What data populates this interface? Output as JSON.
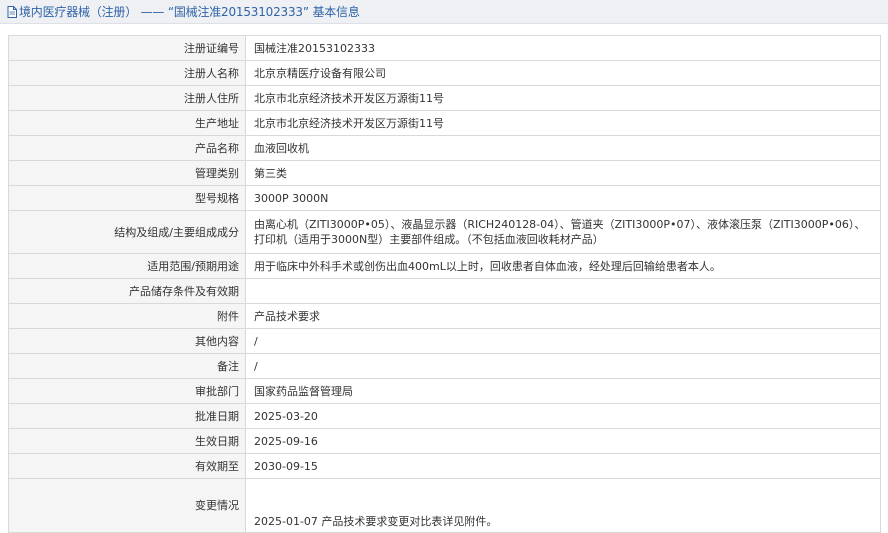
{
  "header": {
    "title": "境内医疗器械（注册） —— “国械注准20153102333” 基本信息",
    "icon": "document-icon"
  },
  "rows": [
    {
      "label": "注册证编号",
      "value": "国械注准20153102333"
    },
    {
      "label": "注册人名称",
      "value": "北京京精医疗设备有限公司"
    },
    {
      "label": "注册人住所",
      "value": "北京市北京经济技术开发区万源街11号"
    },
    {
      "label": "生产地址",
      "value": "北京市北京经济技术开发区万源街11号"
    },
    {
      "label": "产品名称",
      "value": "血液回收机"
    },
    {
      "label": "管理类别",
      "value": "第三类"
    },
    {
      "label": "型号规格",
      "value": "3000P 3000N"
    },
    {
      "label": "结构及组成/主要组成成分",
      "value": "由离心机（ZITI3000P•05）、液晶显示器（RICH240128-04）、管道夹（ZITI3000P•07）、液体滚压泵（ZITI3000P•06）、打印机（适用于3000N型）主要部件组成。（不包括血液回收耗材产品）"
    },
    {
      "label": "适用范围/预期用途",
      "value": "用于临床中外科手术或创伤出血400mL以上时，回收患者自体血液，经处理后回输给患者本人。"
    },
    {
      "label": "产品储存条件及有效期",
      "value": ""
    },
    {
      "label": "附件",
      "value": "产品技术要求"
    },
    {
      "label": "其他内容",
      "value": "/"
    },
    {
      "label": "备注",
      "value": "/"
    },
    {
      "label": "审批部门",
      "value": "国家药品监督管理局"
    },
    {
      "label": "批准日期",
      "value": "2025-03-20"
    },
    {
      "label": "生效日期",
      "value": "2025-09-16"
    },
    {
      "label": "有效期至",
      "value": "2030-09-15"
    },
    {
      "label": "变更情况",
      "value": "2025-01-07 产品技术要求变更对比表详见附件。"
    }
  ]
}
